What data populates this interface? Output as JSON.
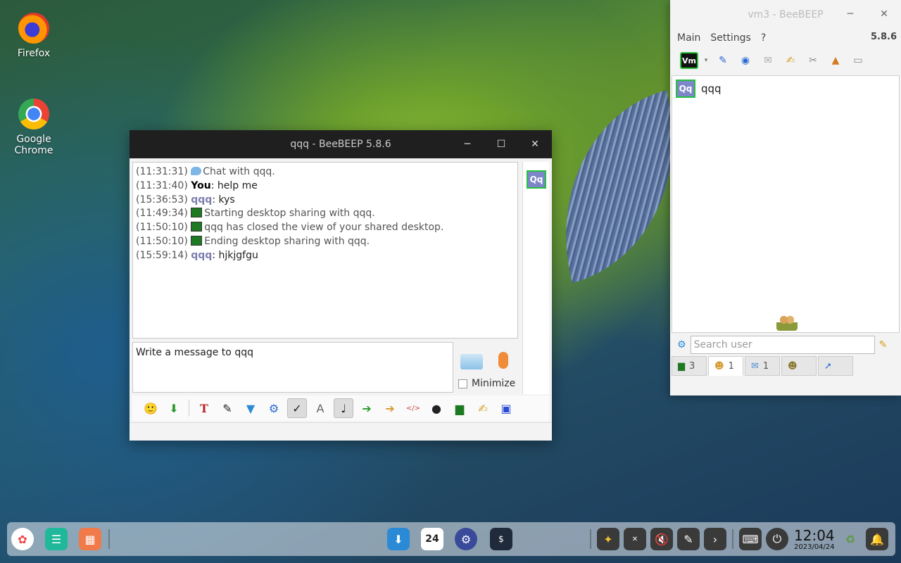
{
  "desktop": {
    "icons": [
      {
        "label": "Firefox"
      },
      {
        "label": "Google Chrome"
      }
    ]
  },
  "chat_window": {
    "title": "qqq - BeeBEEP 5.8.6",
    "window_buttons": {
      "minimize": "─",
      "maximize": "☐",
      "close": "✕"
    },
    "messages": [
      {
        "time": "(11:31:31)",
        "icon": "chat-bubble-icon",
        "text": "Chat with qqq."
      },
      {
        "time": "(11:31:40)",
        "sender": "You",
        "text": ": help me"
      },
      {
        "time": "(15:36:53)",
        "sender": "qqq",
        "text": ": kys"
      },
      {
        "time": "(11:49:34)",
        "icon": "desktop-share-icon",
        "text": "Starting desktop sharing with qqq."
      },
      {
        "time": "(11:50:10)",
        "icon": "desktop-share-icon",
        "text": "qqq has closed the view of your shared desktop."
      },
      {
        "time": "(11:50:10)",
        "icon": "desktop-share-icon",
        "text": "Ending desktop sharing with qqq."
      },
      {
        "time": "(15:59:14)",
        "sender": "qqq",
        "text": ": hjkjgfgu"
      }
    ],
    "avatar": "Qq",
    "input_placeholder": "Write a message to qqq",
    "minimize_label": "Minimize",
    "toolbar_icons": [
      "emoticon-icon",
      "download-icon",
      "font-icon",
      "color-icon",
      "filter-icon",
      "settings-icon",
      "spellcheck-icon",
      "font-box-icon",
      "music-note-icon",
      "file-send-icon",
      "folder-send-icon",
      "html-icon",
      "camera-icon",
      "screen-share-icon",
      "notes-icon",
      "save-icon"
    ]
  },
  "main_window": {
    "title": "vm3 - BeeBEEP",
    "menu": [
      "Main",
      "Settings",
      "?"
    ],
    "version": "5.8.6",
    "toolbar_vm_label": "Vm",
    "user": {
      "avatar": "Qq",
      "name": "qqq"
    },
    "search_placeholder": "Search user",
    "tabs": [
      {
        "icon": "screen-icon",
        "count": "3"
      },
      {
        "icon": "users-icon",
        "count": "1"
      },
      {
        "icon": "chat-icon",
        "count": "1"
      },
      {
        "icon": "group-icon",
        "count": ""
      },
      {
        "icon": "share-icon",
        "count": ""
      }
    ]
  },
  "taskbar": {
    "clock_time": "12:04",
    "clock_date": "2023/04/24",
    "calendar_day": "24"
  },
  "colors": {
    "avatar_bg": "#7c86c8",
    "avatar_border": "#22c23a",
    "qqq_name": "#7b7fae",
    "titlebar_dark": "#1f1f1f"
  }
}
